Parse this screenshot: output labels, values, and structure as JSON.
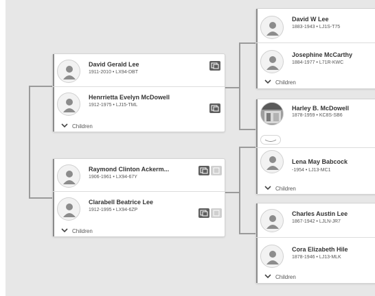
{
  "children_label": "Children",
  "persons": {
    "david_gerald": {
      "name": "David Gerald Lee",
      "info": "1911-2010 • LX94-DBT"
    },
    "henrrietta": {
      "name": "Henrrietta Evelyn McDowell",
      "info": "1912-1975 • LJ15-TML"
    },
    "raymond": {
      "name": "Raymond Clinton Ackerm...",
      "info": "1906-1961 • LX94-67Y"
    },
    "clarabell": {
      "name": "Clarabell Beatrice Lee",
      "info": "1912-1995 • LX94-6ZP"
    },
    "david_w": {
      "name": "David W Lee",
      "info": "1883-1943 • LJ1S-T75"
    },
    "josephine": {
      "name": "Josephine McCarthy",
      "info": "1884-1977 • L71R-KWC"
    },
    "harley": {
      "name": "Harley B. McDowell",
      "info": "1878-1959 • KC8S-SB6"
    },
    "lena": {
      "name": "Lena May Babcock",
      "info": "-1954 • LJ13-MC1"
    },
    "charles": {
      "name": "Charles Austin Lee",
      "info": "1867-1942 • LJLN-JR7"
    },
    "cora": {
      "name": "Cora Elizabeth Hile",
      "info": "1878-1946 • LJ13-MLK"
    }
  },
  "colors": {
    "canvas": "#e7e7e7",
    "card": "#ffffff",
    "connector": "#9a9a9a",
    "badge_dark": "#5e5e5e",
    "badge_light": "#cfcfcf"
  },
  "icons": {
    "avatar": "person-silhouette-icon",
    "photo": "person-photo-icon",
    "children": "chevron-down-icon",
    "record": "record-hint-icon",
    "source": "source-icon",
    "couple": "couple-link-icon"
  }
}
